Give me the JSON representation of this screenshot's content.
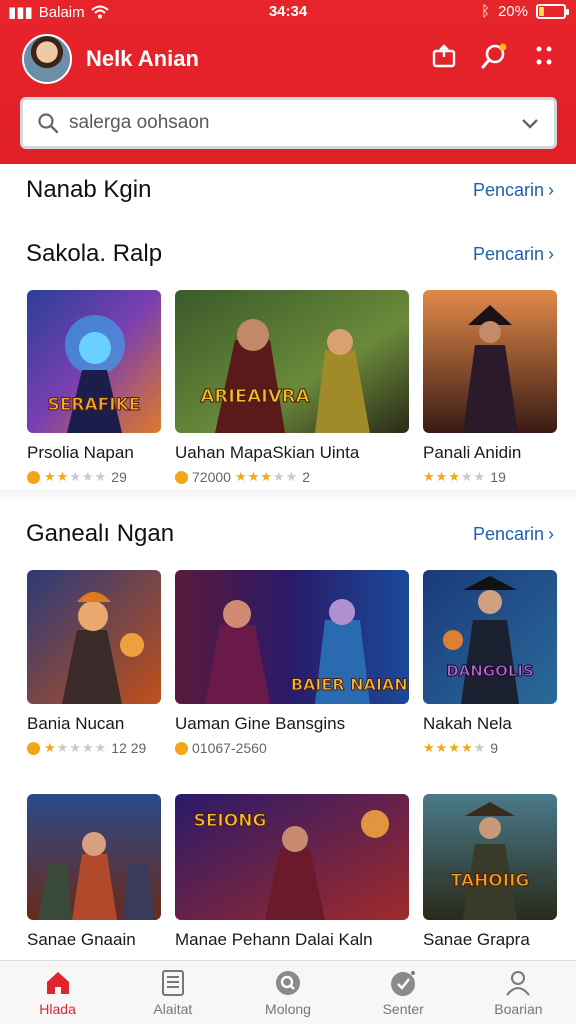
{
  "status_bar": {
    "carrier": "Balaim",
    "time": "34:34",
    "battery": "20%",
    "battery_level": 0.2
  },
  "header": {
    "user_name": "Nelk Anian"
  },
  "search": {
    "placeholder": "salerga oohsaon"
  },
  "sections": [
    {
      "title": "Nanab Kgin",
      "link": "Pencarin"
    },
    {
      "title": "Sakola. Ralp",
      "link": "Pencarin",
      "cards": [
        {
          "title": "Prsolia Napan",
          "meta": "29",
          "rating": 2
        },
        {
          "title": "Uahan MapaSkian Uinta",
          "meta": "72000",
          "extra": "2",
          "rating": 3
        },
        {
          "title": "Panali Anidin",
          "meta": "19",
          "rating": 3
        }
      ]
    },
    {
      "title": "Ganealı Ngan",
      "link": "Pencarin",
      "cards": [
        {
          "title": "Bania Nucan",
          "meta": "12 29",
          "rating": 1
        },
        {
          "title": "Uaman Gine Bansgins",
          "meta": "01067-2560",
          "rating": 0
        },
        {
          "title": "Nakah Nela",
          "meta": "9",
          "rating": 4
        }
      ]
    },
    {
      "cards": [
        {
          "title": "Sanae Gnaain"
        },
        {
          "title": "Manae Pehann Dalai Kaln"
        },
        {
          "title": "Sanae Grapra"
        }
      ]
    }
  ],
  "thumb_labels": [
    "SERAFIKE",
    "ARIEAIVRA",
    "BAIER NAIANS",
    "DANGOLIS",
    "SEIONG",
    "TAHOIIG"
  ],
  "bottom_nav": [
    {
      "label": "Hlada",
      "icon": "home-icon",
      "active": true
    },
    {
      "label": "Alaitat",
      "icon": "list-icon",
      "active": false
    },
    {
      "label": "Molong",
      "icon": "search-circle-icon",
      "active": false
    },
    {
      "label": "Senter",
      "icon": "badge-icon",
      "active": false
    },
    {
      "label": "Boarian",
      "icon": "profile-icon",
      "active": false
    }
  ],
  "colors": {
    "accent": "#e0262d",
    "link": "#1f5fb0",
    "star": "#f0a81a"
  }
}
